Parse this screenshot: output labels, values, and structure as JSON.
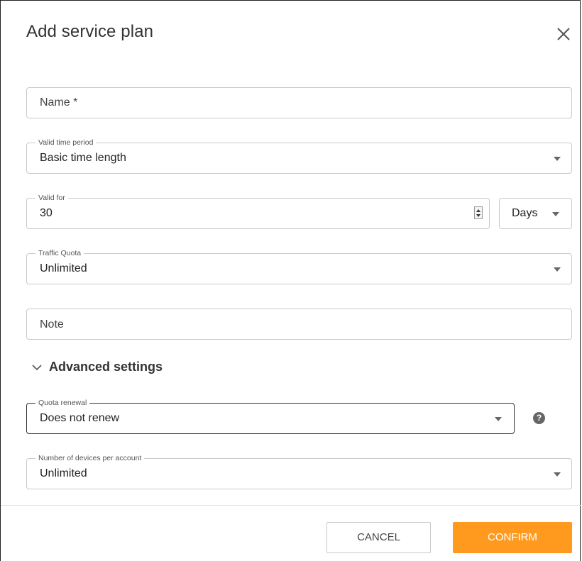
{
  "dialog": {
    "title": "Add service plan"
  },
  "form": {
    "name": {
      "placeholder": "Name *"
    },
    "valid_time_period": {
      "label": "Valid time period",
      "value": "Basic time length"
    },
    "valid_for": {
      "label": "Valid for",
      "value": "30",
      "unit": "Days"
    },
    "traffic_quota": {
      "label": "Traffic Quota",
      "value": "Unlimited"
    },
    "note": {
      "placeholder": "Note"
    },
    "advanced": {
      "label": "Advanced settings"
    },
    "quota_renewal": {
      "label": "Quota renewal",
      "value": "Does not renew"
    },
    "devices_per_account": {
      "label": "Number of devices per account",
      "value": "Unlimited"
    }
  },
  "help_glyph": "?",
  "footer": {
    "cancel_label": "CANCEL",
    "confirm_label": "CONFIRM"
  },
  "colors": {
    "accent": "#ff9a1f",
    "border": "#c9c9c9",
    "text": "#333333"
  }
}
